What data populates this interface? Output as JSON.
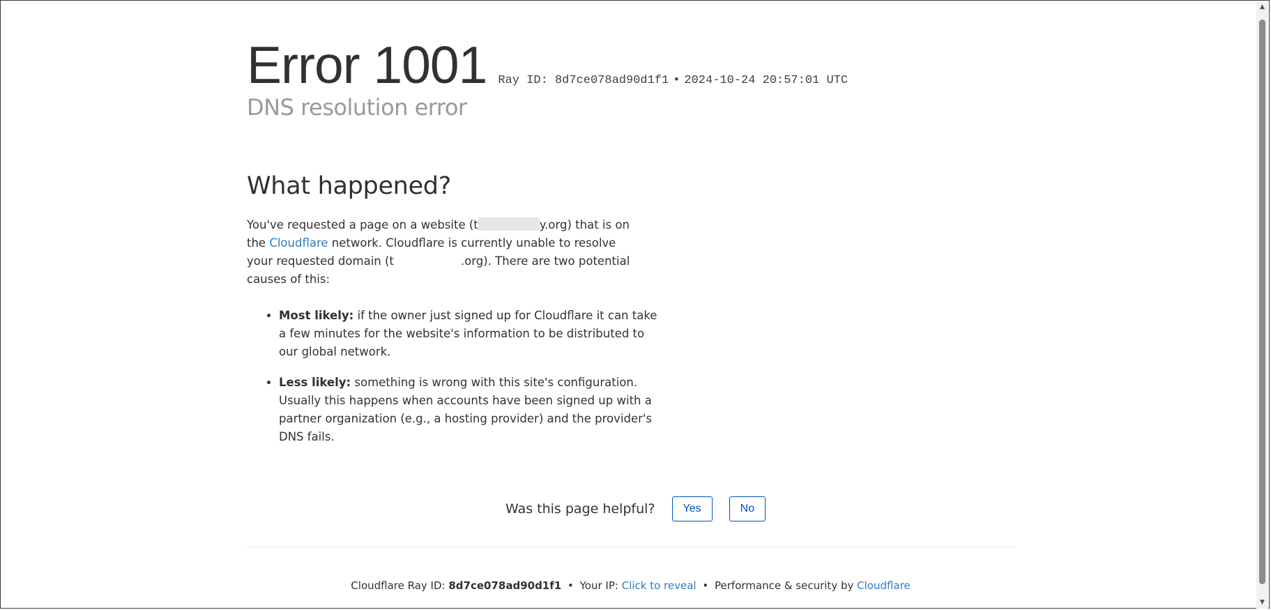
{
  "header": {
    "error_title": "Error 1001",
    "ray_label": "Ray ID: 8d7ce078ad90d1f1",
    "separator": "•",
    "timestamp": "2024-10-24 20:57:01 UTC",
    "subtitle": "DNS resolution error"
  },
  "main": {
    "section_heading": "What happened?",
    "desc_part1": "You've requested a page on a website (t",
    "desc_part2": "y.org) that is on the ",
    "cloudflare_link": "Cloudflare",
    "desc_part3": " network. Cloudflare is currently unable to resolve your requested domain (",
    "desc_part4": "t",
    "desc_part5": ".org). There are two potential causes of this:",
    "causes": [
      {
        "label": "Most likely:",
        "text": " if the owner just signed up for Cloudflare it can take a few minutes for the website's information to be distributed to our global network."
      },
      {
        "label": "Less likely:",
        "text": " something is wrong with this site's configuration. Usually this happens when accounts have been signed up with a partner organization (e.g., a hosting provider) and the provider's DNS fails."
      }
    ]
  },
  "feedback": {
    "question": "Was this page helpful?",
    "yes_label": "Yes",
    "no_label": "No"
  },
  "footer": {
    "ray_prefix": "Cloudflare Ray ID: ",
    "ray_id": "8d7ce078ad90d1f1",
    "bullet": "•",
    "ip_prefix": "Your IP: ",
    "reveal_link": "Click to reveal",
    "perf_text": "Performance & security by ",
    "cloudflare_link": "Cloudflare"
  },
  "colors": {
    "link": "#2f7bbf",
    "button_border": "#0051c3",
    "subtitle": "#999999",
    "text": "#313131"
  },
  "icons": {
    "scroll_up": "scroll-up-arrow-icon",
    "scroll_down": "scroll-down-arrow-icon"
  }
}
